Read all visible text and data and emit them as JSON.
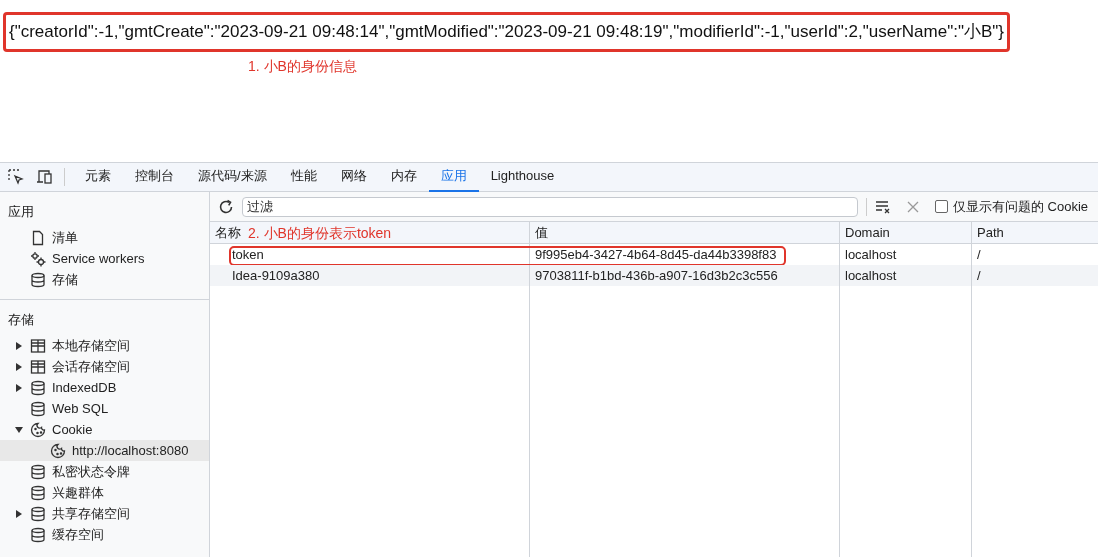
{
  "page": {
    "json_text": "{\"creatorId\":-1,\"gmtCreate\":\"2023-09-21 09:48:14\",\"gmtModified\":\"2023-09-21 09:48:19\",\"modifierId\":-1,\"userId\":2,\"userName\":\"小B\"}",
    "annotation": "1. 小B的身份信息"
  },
  "tabs": [
    {
      "label": "元素",
      "selected": false
    },
    {
      "label": "控制台",
      "selected": false
    },
    {
      "label": "源代码/来源",
      "selected": false
    },
    {
      "label": "性能",
      "selected": false
    },
    {
      "label": "网络",
      "selected": false
    },
    {
      "label": "内存",
      "selected": false
    },
    {
      "label": "应用",
      "selected": true
    },
    {
      "label": "Lighthouse",
      "selected": false
    }
  ],
  "sidebar": {
    "sections": [
      {
        "title": "应用",
        "items": [
          {
            "label": "清单",
            "kind": "file",
            "selected": false
          },
          {
            "label": "Service workers",
            "kind": "gears",
            "selected": false
          },
          {
            "label": "存储",
            "kind": "database",
            "selected": false
          }
        ]
      },
      {
        "title": "存储",
        "items": [
          {
            "label": "本地存储空间",
            "kind": "table",
            "expanded": false,
            "selected": false
          },
          {
            "label": "会话存储空间",
            "kind": "table",
            "expanded": false,
            "selected": false
          },
          {
            "label": "IndexedDB",
            "kind": "database",
            "expanded": false,
            "selected": false
          },
          {
            "label": "Web SQL",
            "kind": "database",
            "selected": false
          },
          {
            "label": "Cookie",
            "kind": "cookie",
            "expanded": true,
            "selected": false,
            "children": [
              {
                "label": "http://localhost:8080",
                "kind": "cookie",
                "selected": true
              }
            ]
          },
          {
            "label": "私密状态令牌",
            "kind": "database",
            "selected": false
          },
          {
            "label": "兴趣群体",
            "kind": "database",
            "selected": false
          },
          {
            "label": "共享存储空间",
            "kind": "database",
            "expanded": false,
            "selected": false
          },
          {
            "label": "缓存空间",
            "kind": "database",
            "selected": false
          }
        ]
      }
    ]
  },
  "toolbar": {
    "filter_placeholder": "过滤",
    "issues_only": {
      "label": "仅显示有问题的 Cookie",
      "checked": false
    }
  },
  "table": {
    "columns": [
      "名称",
      "值",
      "Domain",
      "Path"
    ],
    "annotation": "2. 小B的身份表示token",
    "rows": [
      {
        "cells": [
          "token",
          "9f995eb4-3427-4b64-8d45-da44b3398f83",
          "localhost",
          "/"
        ],
        "highlighted": true
      },
      {
        "cells": [
          "Idea-9109a380",
          "9703811f-b1bd-436b-a907-16d3b2c3c556",
          "localhost",
          "/"
        ],
        "highlighted": false
      }
    ]
  }
}
